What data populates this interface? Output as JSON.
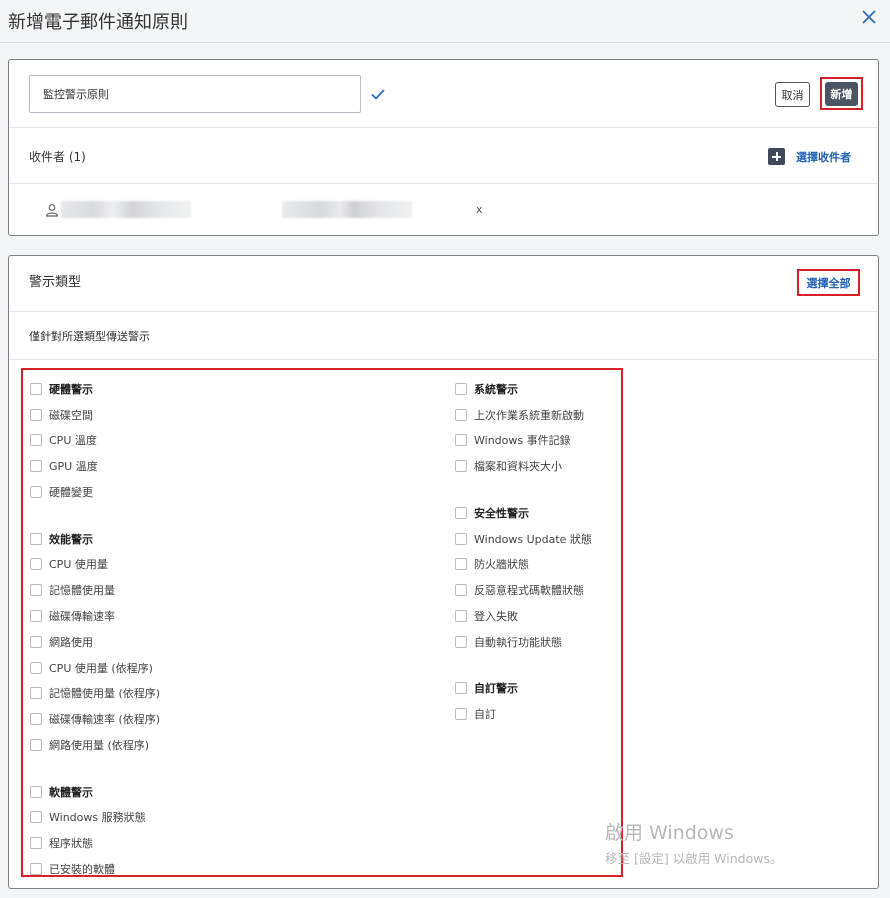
{
  "header": {
    "title": "新增電子郵件通知原則"
  },
  "policy": {
    "name_value": "監控警示原則",
    "cancel_label": "取消",
    "add_label": "新增"
  },
  "recipients": {
    "label": "收件者 (1)",
    "select_label": "選擇收件者",
    "remove_label": "x"
  },
  "alerts": {
    "title": "警示類型",
    "select_all_label": "選擇全部",
    "description": "僅針對所選類型傳送警示",
    "left_groups": [
      {
        "label": "硬體警示",
        "items": [
          "磁碟空間",
          "CPU 溫度",
          "GPU 溫度",
          "硬體變更"
        ]
      },
      {
        "label": "效能警示",
        "items": [
          "CPU 使用量",
          "記憶體使用量",
          "磁碟傳輸速率",
          "網路使用",
          "CPU 使用量 (依程序)",
          "記憶體使用量 (依程序)",
          "磁碟傳輸速率 (依程序)",
          "網路使用量 (依程序)"
        ]
      },
      {
        "label": "軟體警示",
        "items": [
          "Windows 服務狀態",
          "程序狀態",
          "已安裝的軟體"
        ]
      }
    ],
    "right_groups": [
      {
        "label": "系統警示",
        "items": [
          "上次作業系統重新啟動",
          "Windows 事件記錄",
          "檔案和資料夾大小"
        ]
      },
      {
        "label": "安全性警示",
        "items": [
          "Windows Update 狀態",
          "防火牆狀態",
          "反惡意程式碼軟體狀態",
          "登入失敗",
          "自動執行功能狀態"
        ]
      },
      {
        "label": "自訂警示",
        "items": [
          "自訂"
        ]
      }
    ]
  },
  "watermark": {
    "line1": "啟用 Windows",
    "line2": "移至 [設定] 以啟用 Windows。"
  },
  "colors": {
    "highlight": "#d6202a",
    "link": "#1f5fb4",
    "primary_button": "#4a5463"
  }
}
